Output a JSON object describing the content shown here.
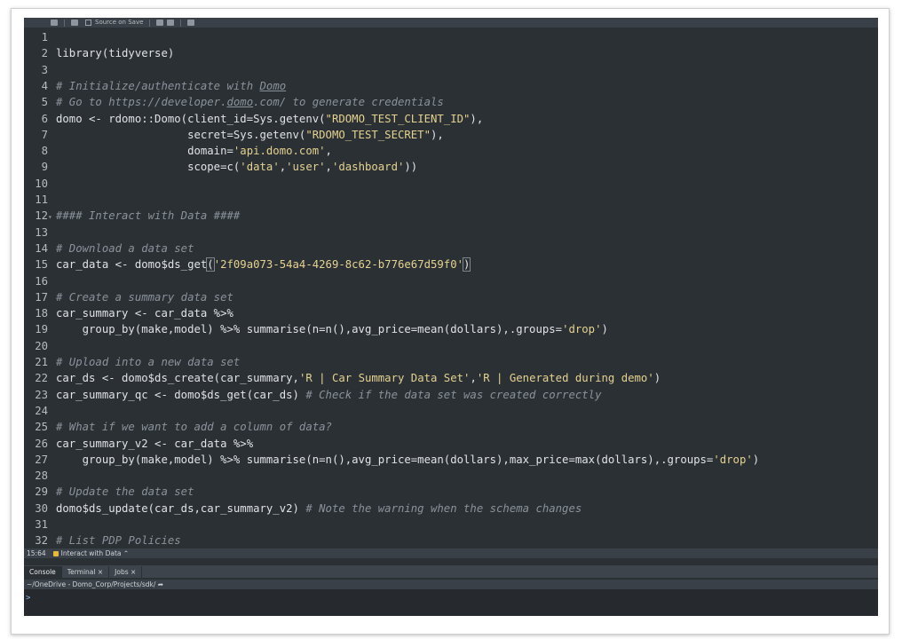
{
  "toolbar": {
    "source_on_save_label": "Source on Save"
  },
  "editor": {
    "lines": [
      {
        "n": "1",
        "fold": "",
        "segments": []
      },
      {
        "n": "2",
        "fold": "",
        "segments": [
          {
            "t": "library(tidyverse)",
            "c": ""
          }
        ]
      },
      {
        "n": "3",
        "fold": "",
        "segments": []
      },
      {
        "n": "4",
        "fold": "",
        "segments": [
          {
            "t": "# Initialize/authenticate with ",
            "c": "kw-com"
          },
          {
            "t": "Domo",
            "c": "kw-com link"
          }
        ]
      },
      {
        "n": "5",
        "fold": "",
        "segments": [
          {
            "t": "# Go to https://developer.",
            "c": "kw-com"
          },
          {
            "t": "domo",
            "c": "kw-com link"
          },
          {
            "t": ".com/ to generate credentials",
            "c": "kw-com"
          }
        ]
      },
      {
        "n": "6",
        "fold": "",
        "segments": [
          {
            "t": "domo <- rdomo::Domo(client_id=Sys.getenv(",
            "c": ""
          },
          {
            "t": "\"RDOMO_TEST_CLIENT_ID\"",
            "c": "kw-str"
          },
          {
            "t": "),",
            "c": ""
          }
        ]
      },
      {
        "n": "7",
        "fold": "",
        "segments": [
          {
            "t": "                    secret=Sys.getenv(",
            "c": ""
          },
          {
            "t": "\"RDOMO_TEST_SECRET\"",
            "c": "kw-str"
          },
          {
            "t": "),",
            "c": ""
          }
        ]
      },
      {
        "n": "8",
        "fold": "",
        "segments": [
          {
            "t": "                    domain=",
            "c": ""
          },
          {
            "t": "'api.domo.com'",
            "c": "kw-str"
          },
          {
            "t": ",",
            "c": ""
          }
        ]
      },
      {
        "n": "9",
        "fold": "",
        "segments": [
          {
            "t": "                    scope=c(",
            "c": ""
          },
          {
            "t": "'data'",
            "c": "kw-str"
          },
          {
            "t": ",",
            "c": ""
          },
          {
            "t": "'user'",
            "c": "kw-str"
          },
          {
            "t": ",",
            "c": ""
          },
          {
            "t": "'dashboard'",
            "c": "kw-str"
          },
          {
            "t": "))",
            "c": ""
          }
        ]
      },
      {
        "n": "10",
        "fold": "",
        "segments": []
      },
      {
        "n": "11",
        "fold": "",
        "segments": []
      },
      {
        "n": "12",
        "fold": "▾",
        "segments": [
          {
            "t": "#### Interact with Data ####",
            "c": "kw-com"
          }
        ]
      },
      {
        "n": "13",
        "fold": "",
        "segments": []
      },
      {
        "n": "14",
        "fold": "",
        "segments": [
          {
            "t": "# Download a data set",
            "c": "kw-com"
          }
        ]
      },
      {
        "n": "15",
        "fold": "",
        "segments": [
          {
            "t": "car_data <- domo$ds_get",
            "c": ""
          },
          {
            "t": "(",
            "c": "hlparen"
          },
          {
            "t": "'2f09a073-54a4-4269-8c62-b776e67d59f0'",
            "c": "kw-str"
          },
          {
            "t": ")",
            "c": "hlparen"
          }
        ]
      },
      {
        "n": "16",
        "fold": "",
        "segments": []
      },
      {
        "n": "17",
        "fold": "",
        "segments": [
          {
            "t": "# Create a summary data set",
            "c": "kw-com"
          }
        ]
      },
      {
        "n": "18",
        "fold": "",
        "segments": [
          {
            "t": "car_summary <- car_data %>%",
            "c": ""
          }
        ]
      },
      {
        "n": "19",
        "fold": "",
        "segments": [
          {
            "t": "    group_by(make,model) %>% summarise(n=n(),avg_price=mean(dollars),.groups=",
            "c": ""
          },
          {
            "t": "'drop'",
            "c": "kw-str"
          },
          {
            "t": ")",
            "c": ""
          }
        ]
      },
      {
        "n": "20",
        "fold": "",
        "segments": []
      },
      {
        "n": "21",
        "fold": "",
        "segments": [
          {
            "t": "# Upload into a new data set",
            "c": "kw-com"
          }
        ]
      },
      {
        "n": "22",
        "fold": "",
        "segments": [
          {
            "t": "car_ds <- domo$ds_create(car_summary,",
            "c": ""
          },
          {
            "t": "'R | Car Summary Data Set'",
            "c": "kw-str"
          },
          {
            "t": ",",
            "c": ""
          },
          {
            "t": "'R | Generated during demo'",
            "c": "kw-str"
          },
          {
            "t": ")",
            "c": ""
          }
        ]
      },
      {
        "n": "23",
        "fold": "",
        "segments": [
          {
            "t": "car_summary_qc <- domo$ds_get(car_ds) ",
            "c": ""
          },
          {
            "t": "# Check if the data set was created correctly",
            "c": "kw-com"
          }
        ]
      },
      {
        "n": "24",
        "fold": "",
        "segments": []
      },
      {
        "n": "25",
        "fold": "",
        "segments": [
          {
            "t": "# What if we want to add a column of data?",
            "c": "kw-com"
          }
        ]
      },
      {
        "n": "26",
        "fold": "",
        "segments": [
          {
            "t": "car_summary_v2 <- car_data %>%",
            "c": ""
          }
        ]
      },
      {
        "n": "27",
        "fold": "",
        "segments": [
          {
            "t": "    group_by(make,model) %>% summarise(n=n(),avg_price=mean(dollars),max_price=max(dollars),.groups=",
            "c": ""
          },
          {
            "t": "'drop'",
            "c": "kw-str"
          },
          {
            "t": ")",
            "c": ""
          }
        ]
      },
      {
        "n": "28",
        "fold": "",
        "segments": []
      },
      {
        "n": "29",
        "fold": "",
        "segments": [
          {
            "t": "# Update the data set",
            "c": "kw-com"
          }
        ]
      },
      {
        "n": "30",
        "fold": "",
        "segments": [
          {
            "t": "domo$ds_update(car_ds,car_summary_v2) ",
            "c": ""
          },
          {
            "t": "# Note the warning when the schema changes",
            "c": "kw-com"
          }
        ]
      },
      {
        "n": "31",
        "fold": "",
        "segments": []
      },
      {
        "n": "32",
        "fold": "",
        "segments": [
          {
            "t": "# List PDP Policies",
            "c": "kw-com"
          }
        ]
      }
    ]
  },
  "statusbar": {
    "cursor": "15:64",
    "section": "Interact with Data"
  },
  "panes": {
    "tabs": [
      {
        "label": "Console",
        "active": true
      },
      {
        "label": "Terminal ×",
        "active": false
      },
      {
        "label": "Jobs ×",
        "active": false
      }
    ],
    "path": "~/OneDrive - Domo_Corp/Projects/sdk/"
  },
  "console": {
    "prompt": ">"
  },
  "colors": {
    "editor_bg": "#2b3035",
    "string": "#e5d28f",
    "comment": "#8a929a",
    "text": "#dfe3e6"
  }
}
